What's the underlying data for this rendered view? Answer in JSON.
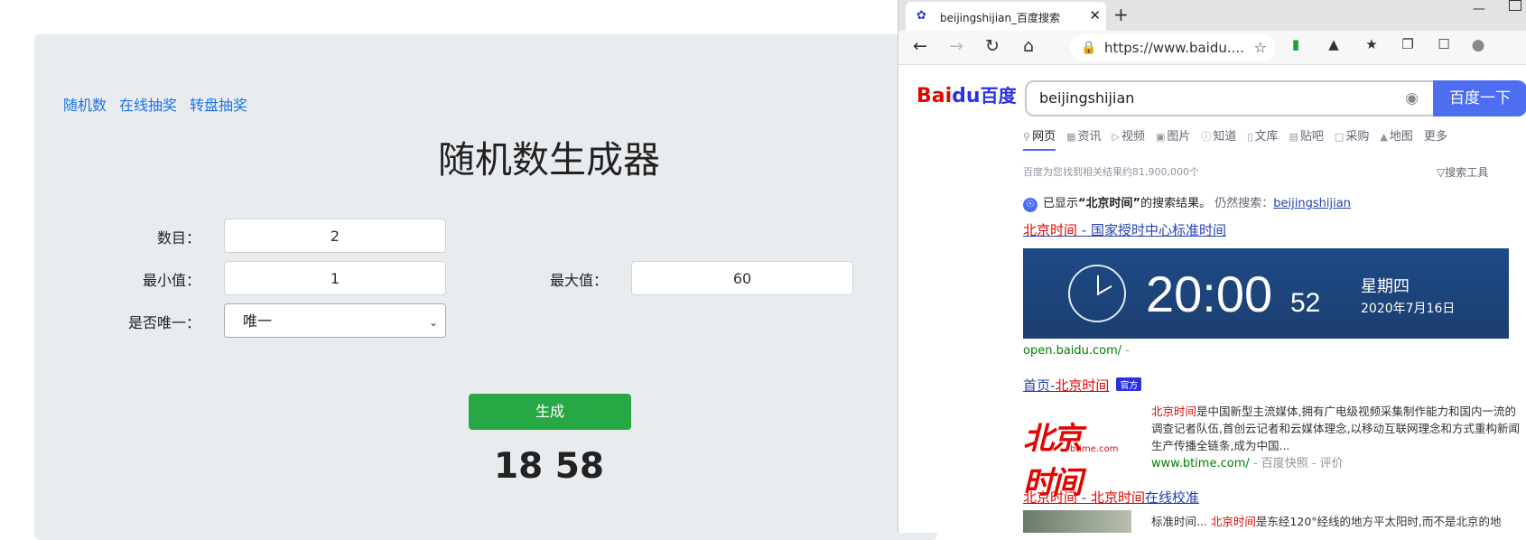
{
  "left_app": {
    "nav": [
      "随机数",
      "在线抽奖",
      "转盘抽奖"
    ],
    "title": "随机数生成器",
    "count_label": "数目：",
    "count_value": "2",
    "min_label": "最小值：",
    "min_value": "1",
    "max_label": "最大值：",
    "max_value": "60",
    "unique_label": "是否唯一：",
    "unique_value": "唯一",
    "generate_label": "生成",
    "result": "18 58"
  },
  "browser": {
    "tab_title": "beijingshijian_百度搜索",
    "url": "https://www.baidu....",
    "icons": [
      "back-icon",
      "forward-icon",
      "refresh-icon",
      "home-icon",
      "lock-icon",
      "star-icon",
      "extension-icon",
      "favorites-icon",
      "collections-icon",
      "profile-icon"
    ]
  },
  "baidu": {
    "logo_text": "Bai",
    "logo_paw": "du",
    "logo_cn": "百度",
    "query": "beijingshijian",
    "search_button": "百度一下",
    "tabs": [
      "网页",
      "资讯",
      "视频",
      "图片",
      "知道",
      "文库",
      "贴吧",
      "采购",
      "地图",
      "更多"
    ],
    "count_text": "百度为您找到相关结果约81,900,000个",
    "tools_text": "搜索工具",
    "shown_prefix": "已显示",
    "shown_term": "“北京时间”",
    "shown_suffix": "的搜索结果。",
    "still_search": "仍然搜索：",
    "still_term": "beijingshijian",
    "r1_title_red": "北京时间",
    "r1_title_rest": " - 国家授时中心标准时间",
    "clock_time": "20:00",
    "clock_sec": "52",
    "clock_week": "星期四",
    "clock_date": "2020年7月16日",
    "r1_url": "open.baidu.com/",
    "r1_url_tail": " - ",
    "r2_title_a": "首页-",
    "r2_title_red": "北京时间",
    "r2_badge": "官方",
    "r2_logo_big": "北京时间",
    "r2_logo_small": "btime.com",
    "r2_snip_red": "北京时间",
    "r2_snip": "是中国新型主流媒体,拥有广电级视频采集制作能力和国内一流的调查记者队伍,首创云记者和云媒体理念,以移动互联网理念和方式重构新闻生产传播全链条,成为中国...",
    "r2_url": "www.btime.com/",
    "r2_url_tail": " - 百度快照 - 评价",
    "r3_title_red": "北京时间",
    "r3_title_mid": " - ",
    "r3_title_red2": "北京时间",
    "r3_title_rest": "在线校准",
    "r3_snip_a": "标准时间... ",
    "r3_snip_red": "北京时间",
    "r3_snip_b": "是东经120°经线的地方平太阳时,而不是北京的地"
  }
}
